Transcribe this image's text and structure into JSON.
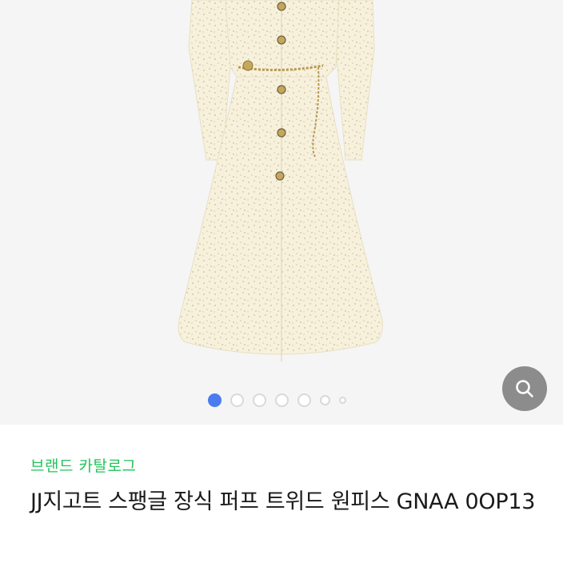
{
  "gallery": {
    "slide_count": 7,
    "active_slide": 1,
    "accent_color": "#4a7cf0",
    "image_subject": "cream tweed dress with gold chain belt and gold buttons",
    "zoom_icon": "search-icon"
  },
  "product": {
    "brand_link": "브랜드 카탈로그",
    "title": "JJ지고트 스팽글 장식 퍼프 트위드 원피스 GNAA 0OP13"
  },
  "colors": {
    "brand_link": "#21c35a",
    "image_bg": "#f5f5f5",
    "dress": "#f7f1dc"
  }
}
